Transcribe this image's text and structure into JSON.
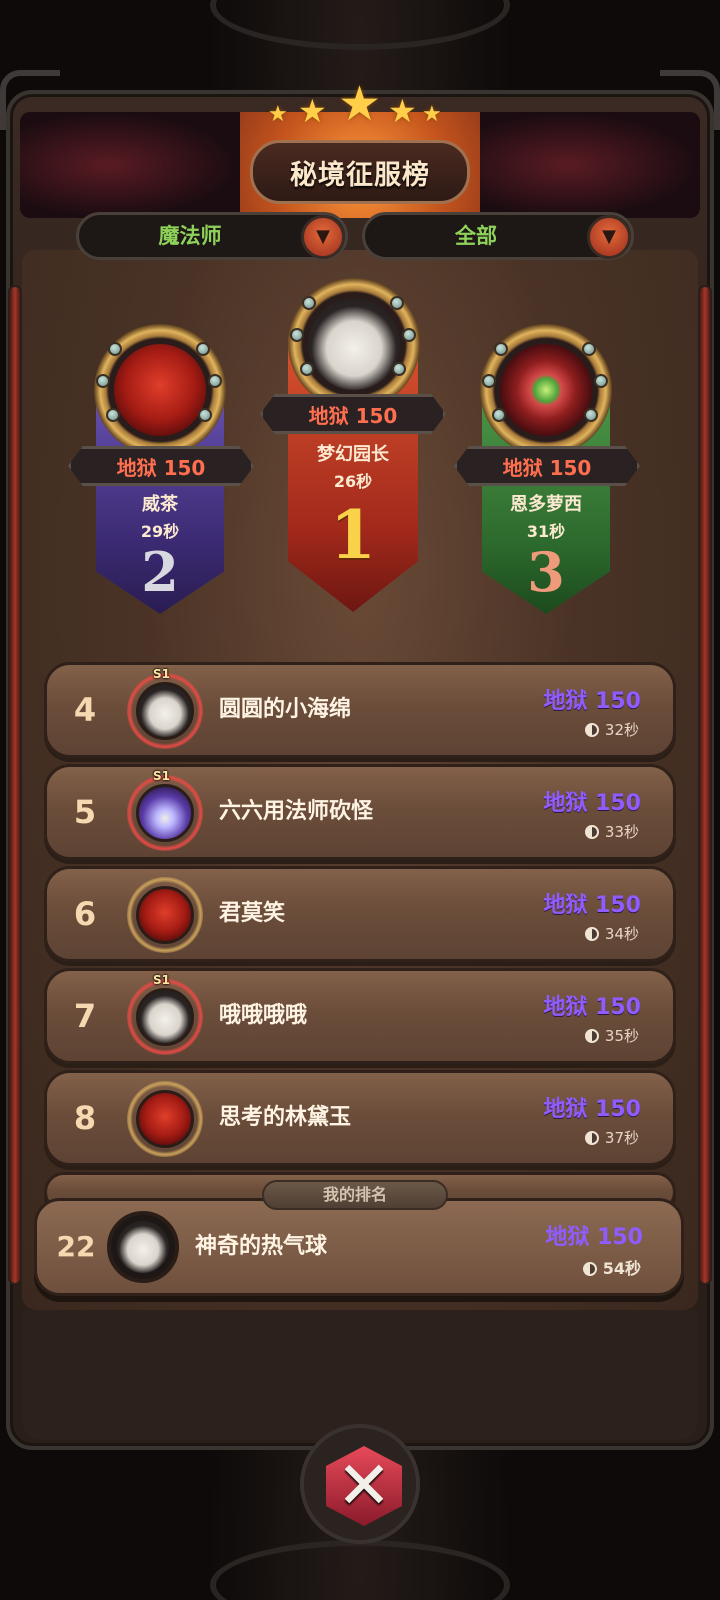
{
  "title": "秘境征服榜",
  "filters": {
    "class": "魔法师",
    "scope": "全部"
  },
  "podium": [
    {
      "rank": "2",
      "floor": "地狱 150",
      "name": "威茶",
      "time": "29秒",
      "avatar": "red-demon-avatar"
    },
    {
      "rank": "1",
      "floor": "地狱 150",
      "name": "梦幻园长",
      "time": "26秒",
      "avatar": "sheep-avatar"
    },
    {
      "rank": "3",
      "floor": "地狱 150",
      "name": "恩多萝西",
      "time": "31秒",
      "avatar": "eye-orb-avatar"
    }
  ],
  "list": [
    {
      "rank": "4",
      "name": "圆圆的小海绵",
      "floor": "地狱 150",
      "time": "32秒",
      "badge": "S1",
      "avatar": "sheep-avatar"
    },
    {
      "rank": "5",
      "name": "六六用法师砍怪",
      "floor": "地狱 150",
      "time": "33秒",
      "badge": "S1",
      "avatar": "purple-mage-avatar"
    },
    {
      "rank": "6",
      "name": "君莫笑",
      "floor": "地狱 150",
      "time": "34秒",
      "badge": "",
      "avatar": "red-demon-avatar"
    },
    {
      "rank": "7",
      "name": "哦哦哦哦",
      "floor": "地狱 150",
      "time": "35秒",
      "badge": "S1",
      "avatar": "sheep-avatar"
    },
    {
      "rank": "8",
      "name": "思考的林黛玉",
      "floor": "地狱 150",
      "time": "37秒",
      "badge": "",
      "avatar": "red-demon-avatar"
    }
  ],
  "my_rank": {
    "label": "我的排名",
    "rank": "22",
    "name": "神奇的热气球",
    "floor": "地狱 150",
    "time": "54秒",
    "avatar": "sheep-avatar"
  },
  "colors": {
    "accent_green": "#8fd25a",
    "floor_red": "#ff6e4f",
    "floor_purple": "#8f5cff"
  }
}
